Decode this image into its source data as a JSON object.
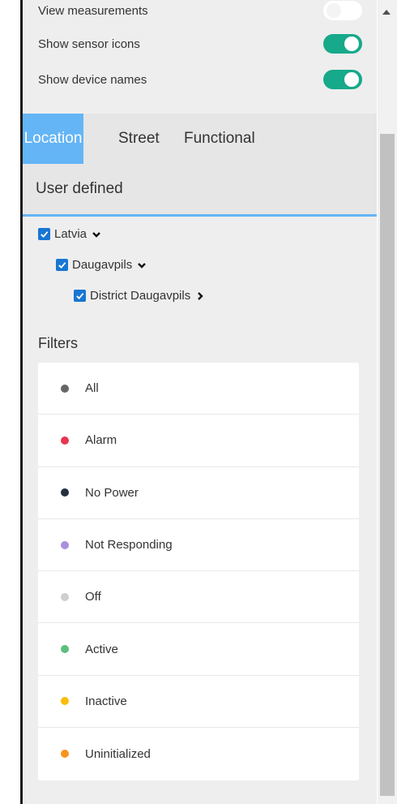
{
  "toggles": [
    {
      "label": "View measurements",
      "state": "off"
    },
    {
      "label": "Show sensor icons",
      "state": "on"
    },
    {
      "label": "Show device names",
      "state": "on"
    }
  ],
  "tabs": {
    "location": "Location",
    "street": "Street",
    "functional": "Functional",
    "user_defined": "User defined",
    "active": "Location"
  },
  "tree": {
    "level1": {
      "label": "Latvia",
      "checked": true,
      "chevron": "chevron-down-icon"
    },
    "level2": {
      "label": "Daugavpils",
      "checked": true,
      "chevron": "chevron-down-icon"
    },
    "level3": {
      "label": "District Daugavpils",
      "checked": true,
      "chevron": "chevron-right-icon"
    }
  },
  "filters": {
    "title": "Filters",
    "items": [
      {
        "label": "All",
        "color": "#666666"
      },
      {
        "label": "Alarm",
        "color": "#e8374e"
      },
      {
        "label": "No Power",
        "color": "#23303f"
      },
      {
        "label": "Not Responding",
        "color": "#a98fdc"
      },
      {
        "label": "Off",
        "color": "#cfcfcf"
      },
      {
        "label": "Active",
        "color": "#5cbf7c"
      },
      {
        "label": "Inactive",
        "color": "#fbbd08"
      },
      {
        "label": "Uninitialized",
        "color": "#f7941d"
      }
    ]
  },
  "colors": {
    "accent": "#64b5f6",
    "toggle_on": "#16a98a",
    "checkbox": "#1976d2"
  }
}
